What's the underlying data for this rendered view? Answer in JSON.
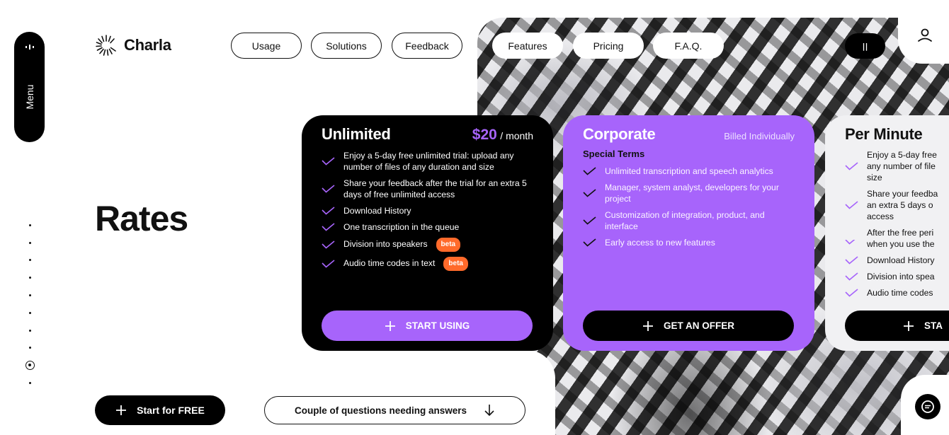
{
  "menu": {
    "label": "Menu",
    "icon": "menu-dots-icon"
  },
  "logo": {
    "text": "Charla",
    "icon": "sunburst-logo-icon"
  },
  "nav": {
    "outlined": [
      {
        "label": "Usage"
      },
      {
        "label": "Solutions"
      },
      {
        "label": "Feedback"
      }
    ],
    "filled": [
      {
        "label": "Features"
      },
      {
        "label": "Pricing"
      },
      {
        "label": "F.A.Q."
      }
    ]
  },
  "pause": {
    "label": "||"
  },
  "user": {
    "icon": "user-icon"
  },
  "page": {
    "title": "Rates"
  },
  "side_dots": {
    "count": 10,
    "active_index": 8
  },
  "cards": {
    "unlimited": {
      "title": "Unlimited",
      "price": "$20",
      "period": "/ month",
      "features": [
        {
          "text": "Enjoy a 5-day free unlimited trial: upload any number of files of any duration and size"
        },
        {
          "text": "Share your feedback after the trial for an extra 5 days of free unlimited access"
        },
        {
          "text": "Download History"
        },
        {
          "text": "One transcription in the queue"
        },
        {
          "text": "Division into speakers",
          "badge": "beta"
        },
        {
          "text": "Audio time codes in text",
          "badge": "beta"
        }
      ],
      "button": "START USING"
    },
    "corporate": {
      "title": "Corporate",
      "billing": "Billed Individually",
      "subtitle": "Special Terms",
      "features": [
        {
          "text": "Unlimited transcription and speech analytics"
        },
        {
          "text": "Manager, system analyst, developers for your project"
        },
        {
          "text": "Customization of integration, product, and interface"
        },
        {
          "text": "Early access to new features"
        }
      ],
      "button": "GET AN OFFER"
    },
    "per_minute": {
      "title": "Per Minute",
      "features": [
        {
          "text": "Enjoy a 5-day free"
        },
        {
          "text": "any number of file"
        },
        {
          "text": "size"
        },
        {
          "text": "Share your feedba"
        },
        {
          "text": "an extra 5 days o"
        },
        {
          "text": "access"
        },
        {
          "text": "After the free peri"
        },
        {
          "text": "when you use the"
        },
        {
          "text": "Download History"
        },
        {
          "text": "Division into spea"
        },
        {
          "text": "Audio time codes"
        }
      ],
      "button": "STA"
    }
  },
  "bottom": {
    "start_free": "Start for FREE",
    "questions": "Couple of questions needing answers"
  },
  "chat": {
    "icon": "chat-icon"
  },
  "colors": {
    "accent": "#a764fb",
    "badge": "#ff6a2b",
    "dark": "#000000"
  }
}
